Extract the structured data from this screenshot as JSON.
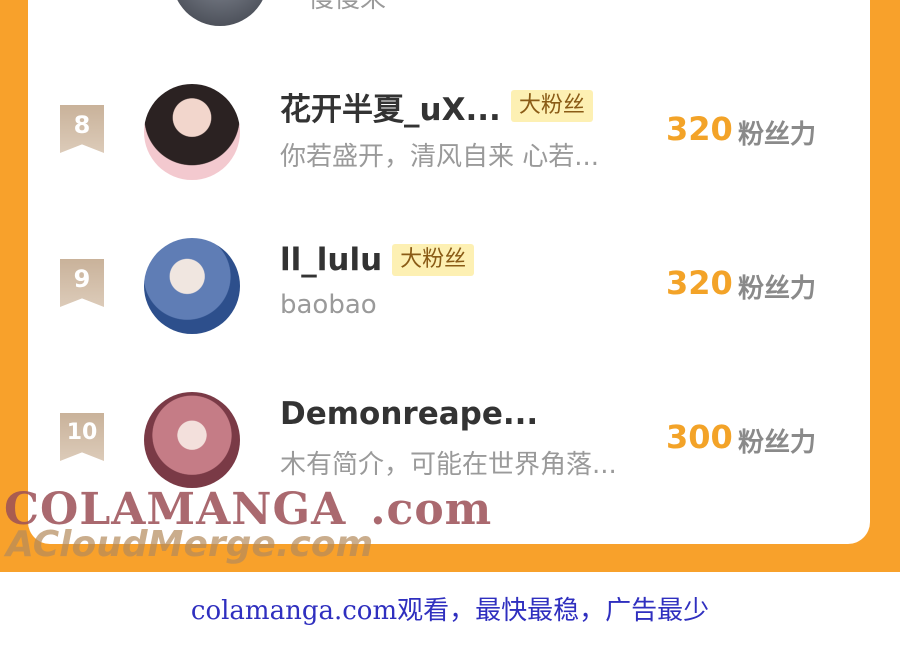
{
  "previous_row": {
    "bio": "慢慢来"
  },
  "rows": [
    {
      "rank": "8",
      "name": "花开半夏_uX...",
      "badge": "大粉丝",
      "bio": "你若盛开，清风自来 心若...",
      "score": "320",
      "unit": "粉丝力"
    },
    {
      "rank": "9",
      "name": "ll_lulu",
      "badge": "大粉丝",
      "bio": "baobao",
      "score": "320",
      "unit": "粉丝力"
    },
    {
      "rank": "10",
      "name": "Demonreape...",
      "badge": "",
      "bio": "木有简介，可能在世界角落...",
      "score": "300",
      "unit": "粉丝力"
    }
  ],
  "watermark": {
    "brand": "COLAMANGA",
    "domain": ".com",
    "secondary": "ACloudMerge.com"
  },
  "footer": "colamanga.com观看，最快最稳，广告最少",
  "colors": {
    "orange": "#f8a12b",
    "score": "#f3a328",
    "badge_bg": "#fdf0b3",
    "footer_text": "#2f2fbf"
  }
}
